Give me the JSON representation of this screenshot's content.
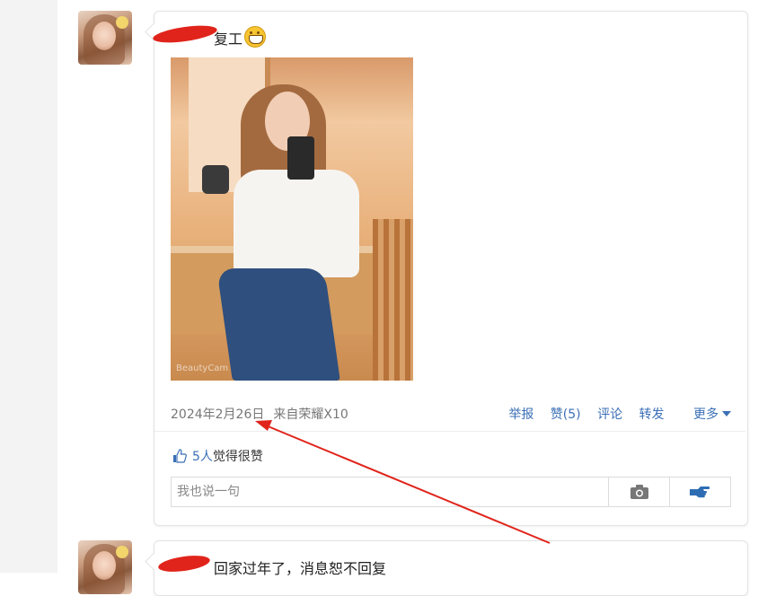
{
  "post1": {
    "text": "复工",
    "emoji": "grinning-face-emoji",
    "photo_watermark": "BeautyCam",
    "date": "2024年2月26日",
    "source": "来自荣耀X10",
    "actions": {
      "report": "举报",
      "like": "赞(5)",
      "comment": "评论",
      "share": "转发",
      "more": "更多"
    },
    "likes": {
      "count_text": "5人",
      "suffix": "觉得很赞"
    },
    "reply": {
      "placeholder": "我也说一句"
    }
  },
  "post2": {
    "text": "回家过年了，消息恕不回复"
  },
  "colors": {
    "link": "#3b6fb6",
    "annotation_red": "#e0241b",
    "sidebar": "#f3f3f3"
  },
  "icons": [
    "thumb-up-icon",
    "camera-icon",
    "point-hand-icon",
    "caret-down-icon"
  ]
}
